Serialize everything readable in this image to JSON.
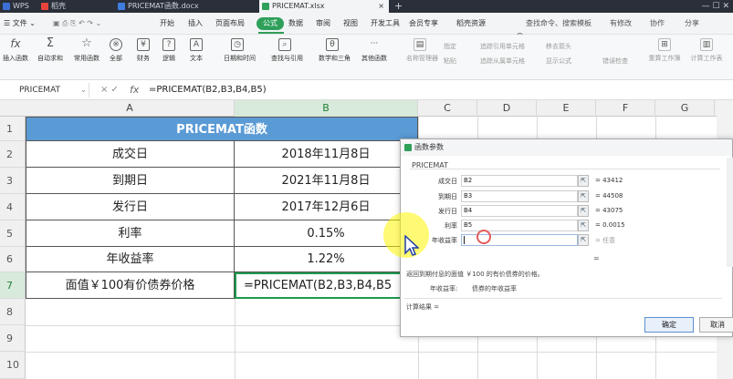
{
  "tabs": {
    "wps": "WPS",
    "shell": "稻壳",
    "docx": "PRICEMAT函数.docx",
    "xlsx": "PRICEMAT.xlsx",
    "plus": "+",
    "winctrl": "— ☐ ✕"
  },
  "menubar": {
    "file": "☰ 文件 ⌄",
    "start": "开始",
    "insert": "插入",
    "layout": "页面布局",
    "formula": "公式",
    "data": "数据",
    "review": "审阅",
    "view": "视图",
    "dev": "开发工具",
    "member": "会员专享",
    "daoke": "稻壳资源",
    "search": "查找命令、搜索模板",
    "unsync": "有修改",
    "collab": "协作",
    "share": "分享"
  },
  "ribbon": {
    "insert_fn": "插入函数",
    "autosum": "自动求和",
    "common": "常用函数",
    "all": "全部",
    "finance": "财务",
    "logic": "逻辑",
    "text": "文本",
    "datetime": "日期和时间",
    "lookup": "查找与引用",
    "math": "数学和三角",
    "other": "其他函数",
    "name_mgr": "名称管理器",
    "specify": "指定",
    "paste": "粘贴",
    "trace_prec": "追踪引用单元格",
    "trace_dep": "追踪从属单元格",
    "remove_arrows": "移去箭头",
    "show_formula": "显示公式",
    "error_check": "错误检查",
    "recalc": "重算工作簿",
    "calc_sheet": "计算工作表"
  },
  "formula_bar": {
    "name": "PRICEMAT",
    "name_arrow": "⌄",
    "controls": "×  ✓",
    "fx": "fx",
    "formula": "=PRICEMAT(B2,B3,B4,B5)"
  },
  "columns": [
    "A",
    "B",
    "C",
    "D",
    "E",
    "F",
    "G"
  ],
  "rows": [
    "1",
    "2",
    "3",
    "4",
    "5",
    "6",
    "7",
    "8",
    "9",
    "10"
  ],
  "sheet": {
    "header": "PRICEMAT函数",
    "rows": [
      {
        "label": "成交日",
        "value": "2018年11月8日"
      },
      {
        "label": "到期日",
        "value": "2021年11月8日"
      },
      {
        "label": "发行日",
        "value": "2017年12月6日"
      },
      {
        "label": "利率",
        "value": "0.15%"
      },
      {
        "label": "年收益率",
        "value": "1.22%"
      },
      {
        "label": "面值￥100有价债券价格",
        "value": "=PRICEMAT(B2,B3,B4,B5"
      }
    ]
  },
  "dialog": {
    "title": "函数参数",
    "fn_name": "PRICEMAT",
    "args": [
      {
        "label": "成交日",
        "input": "B2",
        "result": "= 43412"
      },
      {
        "label": "到期日",
        "input": "B3",
        "result": "= 44508"
      },
      {
        "label": "发行日",
        "input": "B4",
        "result": "= 43075"
      },
      {
        "label": "利率",
        "input": "B5",
        "result": "= 0.0015"
      },
      {
        "label": "年收益率",
        "input": "",
        "result": "= 任意"
      }
    ],
    "equals": "=",
    "desc": "返回到期付息的面值 ￥100 的有价债券的价格。",
    "arg_desc_label": "年收益率:",
    "arg_desc": "债券的年收益率",
    "calc_result": "计算结果 =",
    "ok": "确定",
    "cancel": "取消"
  }
}
